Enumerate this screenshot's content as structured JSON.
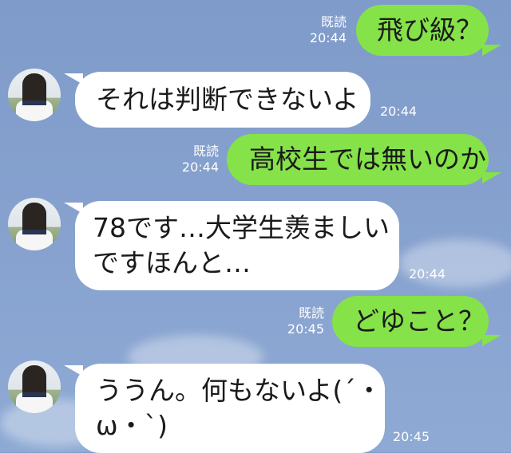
{
  "chat": {
    "read_label": "既読",
    "messages": [
      {
        "id": "m1",
        "side": "sent",
        "text": "飛び級？",
        "time": "20:44"
      },
      {
        "id": "m2",
        "side": "received",
        "text": "それは判断できないよ",
        "time": "20:44"
      },
      {
        "id": "m3",
        "side": "sent",
        "text": "高校生では無いのか",
        "time": "20:44"
      },
      {
        "id": "m4",
        "side": "received",
        "lines": [
          "78です…大学生羨ましい",
          "ですほんと…"
        ],
        "time": "20:44"
      },
      {
        "id": "m5",
        "side": "sent",
        "text": "どゆこと？",
        "time": "20:45"
      },
      {
        "id": "m6",
        "side": "received",
        "lines": [
          "ううん。何もないよ(´・",
          "ω・`)"
        ],
        "time": "20:45"
      }
    ]
  },
  "colors": {
    "background": "#87a2cf",
    "sent_bubble": "#85e249",
    "received_bubble": "#ffffff",
    "meta_text": "#ffffff"
  }
}
